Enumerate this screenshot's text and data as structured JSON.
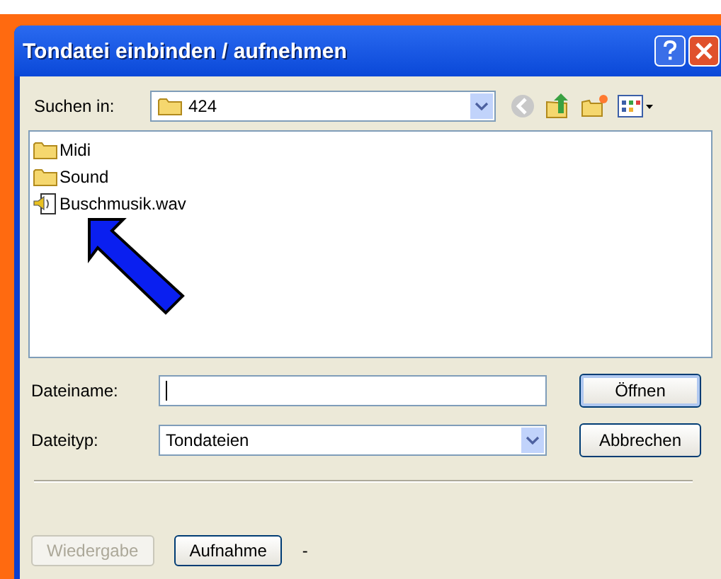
{
  "window": {
    "title": "Tondatei einbinden / aufnehmen"
  },
  "look_in": {
    "label": "Suchen in:",
    "value": "424"
  },
  "files": [
    {
      "kind": "folder",
      "name": "Midi"
    },
    {
      "kind": "folder",
      "name": "Sound"
    },
    {
      "kind": "audio",
      "name": "Buschmusik.wav"
    }
  ],
  "file_name": {
    "label": "Dateiname:"
  },
  "file_type": {
    "label": "Dateityp:",
    "value": "Tondateien"
  },
  "dialog_buttons": [
    {
      "label": "Öffnen",
      "default": true
    },
    {
      "label": "Abbrechen",
      "default": false
    }
  ],
  "bottom_buttons": [
    {
      "label": "Wiedergabe",
      "disabled": true
    },
    {
      "label": "Aufnahme",
      "disabled": false
    }
  ],
  "status": "-"
}
